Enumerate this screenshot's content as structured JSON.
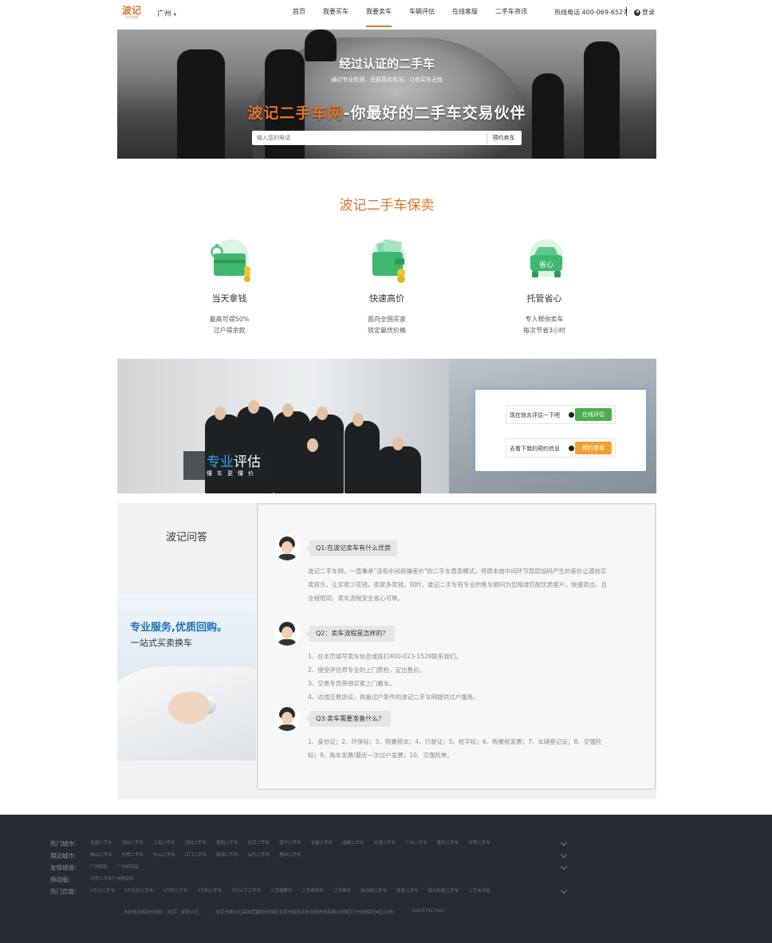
{
  "header": {
    "logo_main": "波记",
    "logo_sub": "二手车网",
    "city": "广州",
    "nav": [
      "首页",
      "我要买车",
      "我要卖车",
      "车辆评估",
      "在线客服",
      "二手车资讯"
    ],
    "active_nav": 2,
    "hotline": "热线电话 400-069-6527",
    "login": "登录"
  },
  "hero": {
    "title": "经过认证的二手车",
    "subtitle": "通过专业检测、还原真实车况，让你买车无忧",
    "slogan_brand": "波记二手车网",
    "slogan_rest": "-你最好的二手车交易伙伴",
    "search_placeholder": "输入您的电话",
    "search_button": "预约卖车"
  },
  "guarantee": {
    "title": "波记二手车保卖",
    "features": [
      {
        "name": "当天拿钱",
        "desc1": "最高可得50%",
        "desc2": "过户得余款",
        "icon": "wallet-clock-icon"
      },
      {
        "name": "快速高价",
        "desc1": "面向全国买家",
        "desc2": "锁定最优价格",
        "icon": "wallet-coins-icon"
      },
      {
        "name": "托管省心",
        "desc1": "专人帮你卖车",
        "desc2": "每次节省3小时",
        "icon": "car-shengxin-icon",
        "icon_text": "省心"
      }
    ]
  },
  "evaluation": {
    "title_blue": "专业",
    "title_white": "评估",
    "subtitle": "懂车更懂价",
    "rows": [
      {
        "text": "现在就去评估一下吧",
        "button": "在线评估",
        "color": "#4cae4c"
      },
      {
        "text": "去看下我的预约信息",
        "button": "预约查看",
        "color": "#f0a030"
      }
    ]
  },
  "qa": {
    "side_title": "波记问答",
    "ad_title": "专业服务,优质回购。",
    "ad_subtitle": "一站式买卖换车",
    "items": [
      {
        "question": "Q1:在波记卖车有什么优势",
        "answer": [
          "波记二手车网，一直秉承\"没有中间商赚差价\"的二手车直卖模式，将原本由中间环节层层加码产生的差价让渡给买",
          "卖双方，让买家少花钱，卖家多卖钱。同时，波记二手车有专业的售车顾问为您精准匹配优质客户，快速卖出，且",
          "全程陪同，卖车流程安全省心可靠。"
        ]
      },
      {
        "question": "Q2：卖车流程是怎样的？",
        "answer": [
          "1、在本页填写卖车信息或拨打400-023-1529联系我们。",
          "2、接受评估师专业的上门质检，定出售价。",
          "3、交易专员带领买家上门看车。",
          "4、达成交易协议，具备过户条件的波记二手车网提供过户服务。"
        ]
      },
      {
        "question": "Q3:卖车需要准备什么？",
        "answer": [
          "1、身份证；2、环保标；3、购置税本；4、行驶证；5、检字标；6、购置税发票；7、车辆登记证；8、交强险",
          "标；9、购车发票/最近一次过户发票；10、交强险单。"
        ]
      }
    ]
  },
  "footer": {
    "rows": [
      {
        "label": "热门城市:",
        "links": [
          "全国二手车",
          "郑州二手车",
          "上海二手车",
          "沈阳二手车",
          "昆明二手车",
          "北京二手车",
          "南宁二手车",
          "长春二手车",
          "成都二手车",
          "天津二手车",
          "广州二手车",
          "重庆二手车",
          "东莞二手车"
        ],
        "chevron": true
      },
      {
        "label": "周边城市:",
        "links": [
          "佛山二手车",
          "东莞二手车",
          "中山二手车",
          "江门二手车",
          "珠海二手车",
          "汕头二手车",
          "惠州二手车"
        ],
        "chevron": true
      },
      {
        "label": "友情链接：",
        "links": [
          "广州商检",
          "广州资讯站"
        ],
        "chevron": true
      },
      {
        "label": "移动版：",
        "links": [
          "贝壳二手车广州移动页"
        ],
        "chevron": false
      },
      {
        "label": "热门页面：",
        "links": [
          "1万元二手车",
          "2万左右二手车",
          "3万的二手车",
          "4万的二手车",
          "5万以下二手车",
          "二手越野车",
          "二手商务车",
          "二手面车",
          "自动挡二手车",
          "急售二手车",
          "低价出售二手车",
          "二手车评估"
        ],
        "chevron": true
      }
    ],
    "copyright": [
      "车好多旧机动车经纪（北京）有限公司",
      "北京市顺义区高丽营镇政府西南(北京市旧机动车交易市场有限公司顺义分市场院内A区01号)",
      "010-57317000"
    ]
  }
}
